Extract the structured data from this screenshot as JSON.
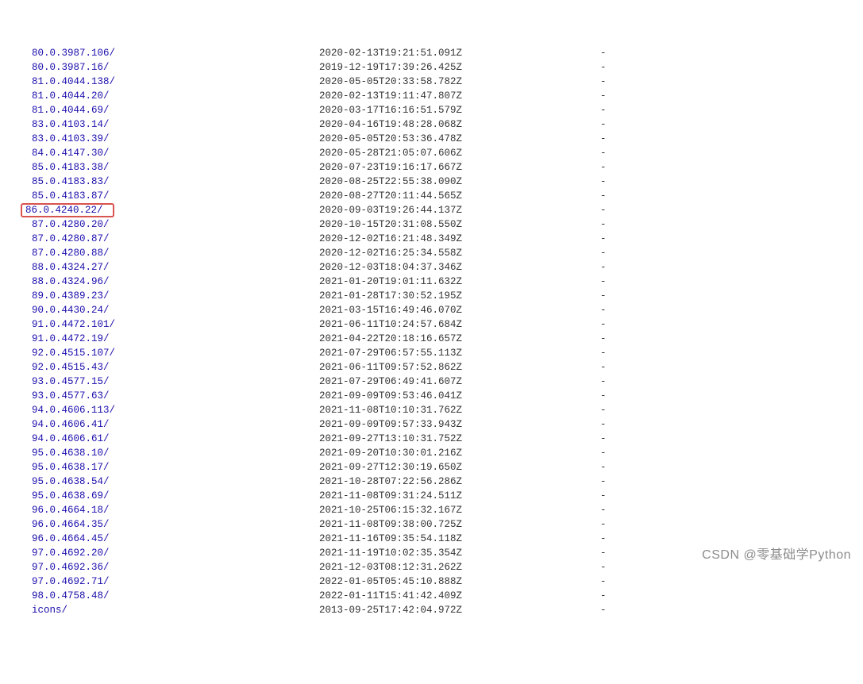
{
  "rows": [
    {
      "name": "80.0.3987.106/",
      "date": "2020-02-13T19:21:51.091Z",
      "size": "-",
      "highlighted": false,
      "partial_top": true
    },
    {
      "name": "80.0.3987.16/",
      "date": "2019-12-19T17:39:26.425Z",
      "size": "-",
      "highlighted": false
    },
    {
      "name": "81.0.4044.138/",
      "date": "2020-05-05T20:33:58.782Z",
      "size": "-",
      "highlighted": false
    },
    {
      "name": "81.0.4044.20/",
      "date": "2020-02-13T19:11:47.807Z",
      "size": "-",
      "highlighted": false
    },
    {
      "name": "81.0.4044.69/",
      "date": "2020-03-17T16:16:51.579Z",
      "size": "-",
      "highlighted": false
    },
    {
      "name": "83.0.4103.14/",
      "date": "2020-04-16T19:48:28.068Z",
      "size": "-",
      "highlighted": false
    },
    {
      "name": "83.0.4103.39/",
      "date": "2020-05-05T20:53:36.478Z",
      "size": "-",
      "highlighted": false
    },
    {
      "name": "84.0.4147.30/",
      "date": "2020-05-28T21:05:07.606Z",
      "size": "-",
      "highlighted": false
    },
    {
      "name": "85.0.4183.38/",
      "date": "2020-07-23T19:16:17.667Z",
      "size": "-",
      "highlighted": false
    },
    {
      "name": "85.0.4183.83/",
      "date": "2020-08-25T22:55:38.090Z",
      "size": "-",
      "highlighted": false
    },
    {
      "name": "85.0.4183.87/",
      "date": "2020-08-27T20:11:44.565Z",
      "size": "-",
      "highlighted": false
    },
    {
      "name": "86.0.4240.22/",
      "date": "2020-09-03T19:26:44.137Z",
      "size": "-",
      "highlighted": true
    },
    {
      "name": "87.0.4280.20/",
      "date": "2020-10-15T20:31:08.550Z",
      "size": "-",
      "highlighted": false
    },
    {
      "name": "87.0.4280.87/",
      "date": "2020-12-02T16:21:48.349Z",
      "size": "-",
      "highlighted": false
    },
    {
      "name": "87.0.4280.88/",
      "date": "2020-12-02T16:25:34.558Z",
      "size": "-",
      "highlighted": false
    },
    {
      "name": "88.0.4324.27/",
      "date": "2020-12-03T18:04:37.346Z",
      "size": "-",
      "highlighted": false
    },
    {
      "name": "88.0.4324.96/",
      "date": "2021-01-20T19:01:11.632Z",
      "size": "-",
      "highlighted": false
    },
    {
      "name": "89.0.4389.23/",
      "date": "2021-01-28T17:30:52.195Z",
      "size": "-",
      "highlighted": false
    },
    {
      "name": "90.0.4430.24/",
      "date": "2021-03-15T16:49:46.070Z",
      "size": "-",
      "highlighted": false
    },
    {
      "name": "91.0.4472.101/",
      "date": "2021-06-11T10:24:57.684Z",
      "size": "-",
      "highlighted": false
    },
    {
      "name": "91.0.4472.19/",
      "date": "2021-04-22T20:18:16.657Z",
      "size": "-",
      "highlighted": false
    },
    {
      "name": "92.0.4515.107/",
      "date": "2021-07-29T06:57:55.113Z",
      "size": "-",
      "highlighted": false
    },
    {
      "name": "92.0.4515.43/",
      "date": "2021-06-11T09:57:52.862Z",
      "size": "-",
      "highlighted": false
    },
    {
      "name": "93.0.4577.15/",
      "date": "2021-07-29T06:49:41.607Z",
      "size": "-",
      "highlighted": false
    },
    {
      "name": "93.0.4577.63/",
      "date": "2021-09-09T09:53:46.041Z",
      "size": "-",
      "highlighted": false
    },
    {
      "name": "94.0.4606.113/",
      "date": "2021-11-08T10:10:31.762Z",
      "size": "-",
      "highlighted": false
    },
    {
      "name": "94.0.4606.41/",
      "date": "2021-09-09T09:57:33.943Z",
      "size": "-",
      "highlighted": false
    },
    {
      "name": "94.0.4606.61/",
      "date": "2021-09-27T13:10:31.752Z",
      "size": "-",
      "highlighted": false
    },
    {
      "name": "95.0.4638.10/",
      "date": "2021-09-20T10:30:01.216Z",
      "size": "-",
      "highlighted": false
    },
    {
      "name": "95.0.4638.17/",
      "date": "2021-09-27T12:30:19.650Z",
      "size": "-",
      "highlighted": false
    },
    {
      "name": "95.0.4638.54/",
      "date": "2021-10-28T07:22:56.286Z",
      "size": "-",
      "highlighted": false
    },
    {
      "name": "95.0.4638.69/",
      "date": "2021-11-08T09:31:24.511Z",
      "size": "-",
      "highlighted": false
    },
    {
      "name": "96.0.4664.18/",
      "date": "2021-10-25T06:15:32.167Z",
      "size": "-",
      "highlighted": false
    },
    {
      "name": "96.0.4664.35/",
      "date": "2021-11-08T09:38:00.725Z",
      "size": "-",
      "highlighted": false
    },
    {
      "name": "96.0.4664.45/",
      "date": "2021-11-16T09:35:54.118Z",
      "size": "-",
      "highlighted": false
    },
    {
      "name": "97.0.4692.20/",
      "date": "2021-11-19T10:02:35.354Z",
      "size": "-",
      "highlighted": false
    },
    {
      "name": "97.0.4692.36/",
      "date": "2021-12-03T08:12:31.262Z",
      "size": "-",
      "highlighted": false
    },
    {
      "name": "97.0.4692.71/",
      "date": "2022-01-05T05:45:10.888Z",
      "size": "-",
      "highlighted": false
    },
    {
      "name": "98.0.4758.48/",
      "date": "2022-01-11T15:41:42.409Z",
      "size": "-",
      "highlighted": false
    },
    {
      "name": "icons/",
      "date": "2013-09-25T17:42:04.972Z",
      "size": "-",
      "highlighted": false
    }
  ],
  "watermark": "CSDN @零基础学Python"
}
